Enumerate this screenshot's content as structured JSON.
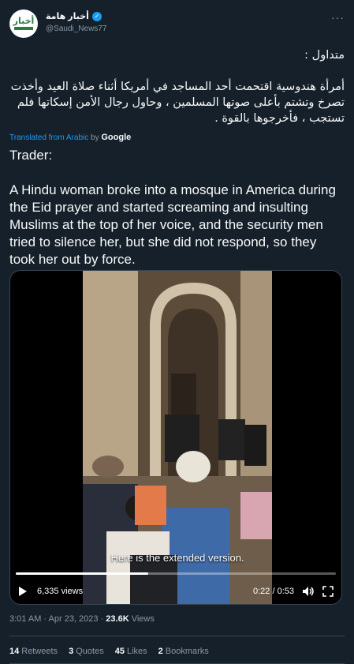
{
  "author": {
    "display_name": "أخبار هامة",
    "handle": "@Saudi_News77",
    "avatar_text": "أخبار",
    "verified_icon": "verified-badge-icon"
  },
  "tweet": {
    "arabic_text": "متداول :\n\nأمرأة هندوسية اقتحمت أحد المساجد في أمريكا أثناء صلاة العيد وأخذت تصرخ وتشتم بأعلى صوتها المسلمين ، وحاول رجال الأمن إسكاتها فلم تستجب ، فأخرجوها بالقوة .",
    "translated_from": "Translated from Arabic",
    "by": "by",
    "translator": "Google",
    "english_text": "Trader:\n\nA Hindu woman broke into a mosque in America during the Eid prayer and started screaming and insulting Muslims at the top of her voice, and the security men tried to silence her, but she did not respond, so they took her out by force."
  },
  "video": {
    "caption": "Here is the extended version.",
    "views": "6,335 views",
    "time": "0:22 / 0:53",
    "progress": 0.415
  },
  "meta": {
    "timestamp": "3:01 AM · Apr 23, 2023 · ",
    "view_count": "23.6K",
    "views_label": " Views"
  },
  "stats": [
    {
      "value": "14",
      "label": "Retweets"
    },
    {
      "value": "3",
      "label": "Quotes"
    },
    {
      "value": "45",
      "label": "Likes"
    },
    {
      "value": "2",
      "label": "Bookmarks"
    }
  ],
  "colors": {
    "background": "#15202b",
    "accent": "#1d9bf0",
    "muted": "#8b98a5"
  }
}
